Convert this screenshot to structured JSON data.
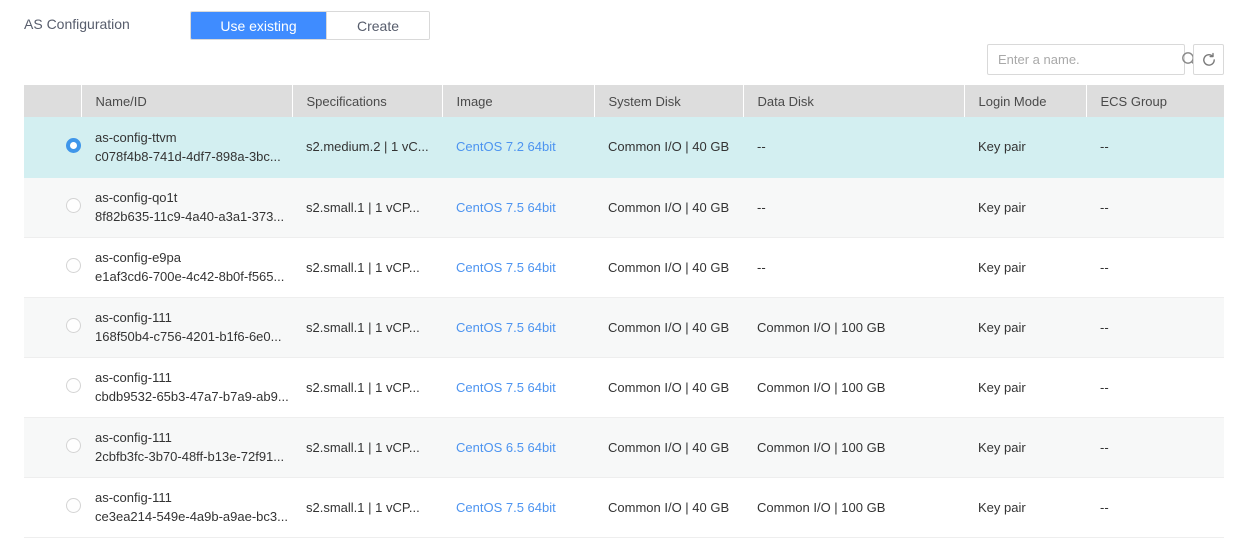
{
  "header": {
    "as_config_label": "AS Configuration",
    "segmented": [
      {
        "label": "Use existing",
        "active": true
      },
      {
        "label": "Create",
        "active": false
      }
    ]
  },
  "search": {
    "placeholder": "Enter a name.",
    "value": "",
    "search_icon": "search-icon",
    "refresh_icon": "refresh-icon",
    "refresh_title": "Refresh"
  },
  "table": {
    "columns": [
      {
        "key": "radio",
        "label": ""
      },
      {
        "key": "name",
        "label": "Name/ID"
      },
      {
        "key": "spec",
        "label": "Specifications"
      },
      {
        "key": "image",
        "label": "Image"
      },
      {
        "key": "sysdisk",
        "label": "System Disk"
      },
      {
        "key": "datadisk",
        "label": "Data Disk"
      },
      {
        "key": "login",
        "label": "Login Mode"
      },
      {
        "key": "ecs",
        "label": "ECS Group"
      }
    ],
    "rows": [
      {
        "selected": true,
        "name": "as-config-ttvm",
        "id": "c078f4b8-741d-4df7-898a-3bc...",
        "spec": "s2.medium.2 | 1 vC...",
        "image": "CentOS 7.2 64bit",
        "sysdisk": "Common I/O | 40 GB",
        "datadisk": "--",
        "login": "Key pair",
        "ecs": "--"
      },
      {
        "selected": false,
        "name": "as-config-qo1t",
        "id": "8f82b635-11c9-4a40-a3a1-373...",
        "spec": "s2.small.1 | 1 vCP...",
        "image": "CentOS 7.5 64bit",
        "sysdisk": "Common I/O | 40 GB",
        "datadisk": "--",
        "login": "Key pair",
        "ecs": "--"
      },
      {
        "selected": false,
        "name": "as-config-e9pa",
        "id": "e1af3cd6-700e-4c42-8b0f-f565...",
        "spec": "s2.small.1 | 1 vCP...",
        "image": "CentOS 7.5 64bit",
        "sysdisk": "Common I/O | 40 GB",
        "datadisk": "--",
        "login": "Key pair",
        "ecs": "--"
      },
      {
        "selected": false,
        "name": "as-config-111",
        "id": "168f50b4-c756-4201-b1f6-6e0...",
        "spec": "s2.small.1 | 1 vCP...",
        "image": "CentOS 7.5 64bit",
        "sysdisk": "Common I/O | 40 GB",
        "datadisk": "Common I/O | 100 GB",
        "login": "Key pair",
        "ecs": "--"
      },
      {
        "selected": false,
        "name": "as-config-111",
        "id": "cbdb9532-65b3-47a7-b7a9-ab9...",
        "spec": "s2.small.1 | 1 vCP...",
        "image": "CentOS 7.5 64bit",
        "sysdisk": "Common I/O | 40 GB",
        "datadisk": "Common I/O | 100 GB",
        "login": "Key pair",
        "ecs": "--"
      },
      {
        "selected": false,
        "name": "as-config-111",
        "id": "2cbfb3fc-3b70-48ff-b13e-72f91...",
        "spec": "s2.small.1 | 1 vCP...",
        "image": "CentOS 6.5 64bit",
        "sysdisk": "Common I/O | 40 GB",
        "datadisk": "Common I/O | 100 GB",
        "login": "Key pair",
        "ecs": "--"
      },
      {
        "selected": false,
        "name": "as-config-111",
        "id": "ce3ea214-549e-4a9b-a9ae-bc3...",
        "spec": "s2.small.1 | 1 vCP...",
        "image": "CentOS 7.5 64bit",
        "sysdisk": "Common I/O | 40 GB",
        "datadisk": "Common I/O | 100 GB",
        "login": "Key pair",
        "ecs": "--"
      }
    ]
  },
  "colors": {
    "accent": "#3f8cff",
    "selected_row": "#d3eff1",
    "link": "#4d94f0",
    "header_bg": "#dddddd",
    "stripe": "#f7f8f8"
  }
}
